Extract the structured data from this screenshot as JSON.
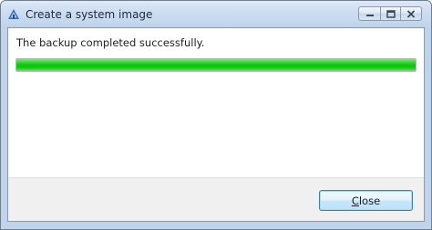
{
  "window": {
    "title": "Create a system image",
    "app_icon": "system-image-icon",
    "caption_buttons": [
      "minimize-icon",
      "maximize-icon",
      "close-icon"
    ]
  },
  "main": {
    "status_message": "The backup completed successfully.",
    "progress_percent": 100,
    "progress_color": "#18cc18"
  },
  "footer": {
    "close_button": {
      "access_key": "C",
      "label_rest": "lose"
    }
  }
}
